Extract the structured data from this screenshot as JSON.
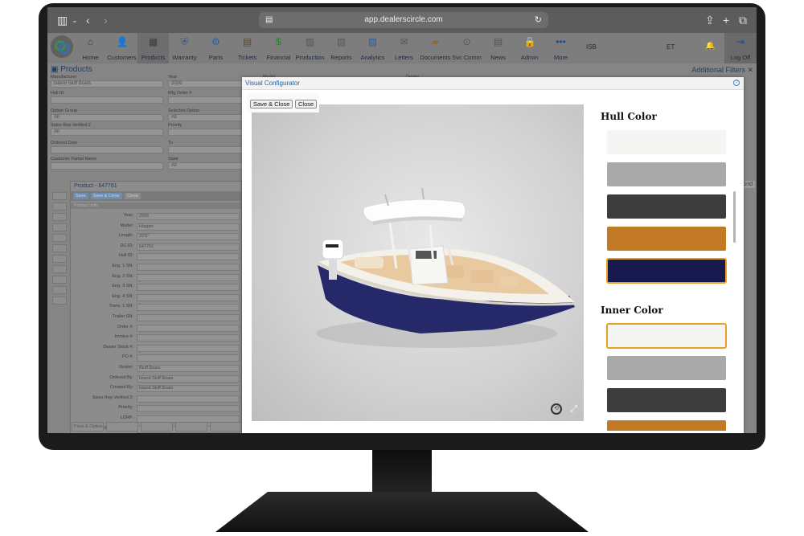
{
  "browser": {
    "url": "app.dealerscircle.com",
    "icons": [
      "sidebar-icon",
      "chevron-down-icon",
      "back-icon",
      "forward-icon",
      "page-icon",
      "reload-icon",
      "share-icon",
      "plus-icon",
      "tabs-icon"
    ]
  },
  "nav": {
    "items": [
      {
        "label": "Home",
        "icon": "home-icon",
        "color": "#1e4a7a"
      },
      {
        "label": "Customers",
        "icon": "customers-icon",
        "color": "#2b6cb0"
      },
      {
        "label": "Products",
        "icon": "products-icon",
        "color": "#3b3b3b"
      },
      {
        "label": "Warranty",
        "icon": "warranty-icon",
        "color": "#2457a0"
      },
      {
        "label": "Parts",
        "icon": "parts-icon",
        "color": "#2a5f9e"
      },
      {
        "label": "Tickets",
        "icon": "tickets-icon",
        "color": "#5a4a3a"
      },
      {
        "label": "Financial",
        "icon": "financial-icon",
        "color": "#2e7d32"
      },
      {
        "label": "Production",
        "icon": "production-icon",
        "color": "#555555"
      },
      {
        "label": "Reports",
        "icon": "reports-icon",
        "color": "#5a5a5a"
      },
      {
        "label": "Analytics",
        "icon": "analytics-icon",
        "color": "#2a5f9e"
      },
      {
        "label": "Letters",
        "icon": "letters-icon",
        "color": "#555555"
      },
      {
        "label": "Documents",
        "icon": "documents-icon",
        "color": "#8a6a3a"
      },
      {
        "label": "Svc Comm",
        "icon": "svc-comm-icon",
        "color": "#555555"
      },
      {
        "label": "News",
        "icon": "news-icon",
        "color": "#555555"
      },
      {
        "label": "Admin",
        "icon": "admin-icon",
        "color": "#555555"
      },
      {
        "label": "More",
        "icon": "more-icon",
        "color": "#1e4a7a"
      }
    ],
    "isb": "ISB",
    "et": "ET",
    "logoff": "Log Off"
  },
  "products_page": {
    "title": "Products",
    "additional_filters": "Additional Filters",
    "fields": [
      {
        "label": "Manufacturer",
        "value": "Island Skiff Boats"
      },
      {
        "label": "Year",
        "value": "2026"
      },
      {
        "label": "Model",
        "value": ""
      },
      {
        "label": "Dealer",
        "value": ""
      },
      {
        "label": "Hull ID",
        "value": ""
      },
      {
        "label": "Mfg Order #",
        "value": ""
      },
      {
        "label": "Option Group",
        "value": "All"
      },
      {
        "label": "Selected Option",
        "value": "All"
      },
      {
        "label": "Sales Rep Verified 2",
        "value": "All"
      },
      {
        "label": "Priority",
        "value": ""
      },
      {
        "label": "Ordered Date",
        "value": ""
      },
      {
        "label": "To",
        "value": ""
      },
      {
        "label": "Customer Partial Name",
        "value": ""
      },
      {
        "label": "State",
        "value": "All"
      }
    ],
    "grid_button": "Grid",
    "product_panel": {
      "title": "Product - 647761",
      "buttons": [
        "Save",
        "Save & Close",
        "Close"
      ],
      "section": "Product Info",
      "rows": [
        {
          "label": "Year:",
          "value": "2026"
        },
        {
          "label": "Model:",
          "value": "Hopper"
        },
        {
          "label": "Length:",
          "value": "22'6\""
        },
        {
          "label": "DC ID:",
          "value": "647761"
        },
        {
          "label": "Hull ID:",
          "value": ""
        },
        {
          "label": "Eng. 1 SN:",
          "value": ""
        },
        {
          "label": "Eng. 2 SN:",
          "value": ""
        },
        {
          "label": "Eng. 3 SN:",
          "value": ""
        },
        {
          "label": "Eng. 4 SN:",
          "value": ""
        },
        {
          "label": "Trans. 1 SN:",
          "value": ""
        },
        {
          "label": "Trailer SN:",
          "value": ""
        },
        {
          "label": "Order #:",
          "value": ""
        },
        {
          "label": "Invoice #:",
          "value": ""
        },
        {
          "label": "Dealer Stock #:",
          "value": ""
        },
        {
          "label": "PO #:",
          "value": ""
        },
        {
          "label": "Dealer:",
          "value": "Bluff Boats"
        },
        {
          "label": "Ordered By:",
          "value": "Island Skiff Boats"
        },
        {
          "label": "Created By:",
          "value": "Island Skiff Boats"
        },
        {
          "label": "Sales Rep Verified 2:",
          "value": ""
        },
        {
          "label": "Priority:",
          "value": ""
        },
        {
          "label": "LORF:",
          "value": ""
        },
        {
          "label": "Factory Approved:",
          "value": ""
        }
      ],
      "bottom_tabs": [
        "Price & Options",
        "",
        "",
        "",
        "",
        "",
        ""
      ]
    }
  },
  "configurator": {
    "title": "Visual Configurator",
    "help": "?",
    "save_close": "Save & Close",
    "close": "Close",
    "hull": {
      "heading": "Hull Color",
      "swatches": [
        "#f5f5f3",
        "#a9a9a9",
        "#3c3c3c",
        "#c37a26",
        "#171a4e"
      ],
      "selected": 4
    },
    "inner": {
      "heading": "Inner Color",
      "swatches": [
        "#f5f5f3",
        "#a9a9a9",
        "#3c3c3c",
        "#c37a26"
      ],
      "selected": 0
    },
    "boat_hull_color": "#25296a"
  }
}
